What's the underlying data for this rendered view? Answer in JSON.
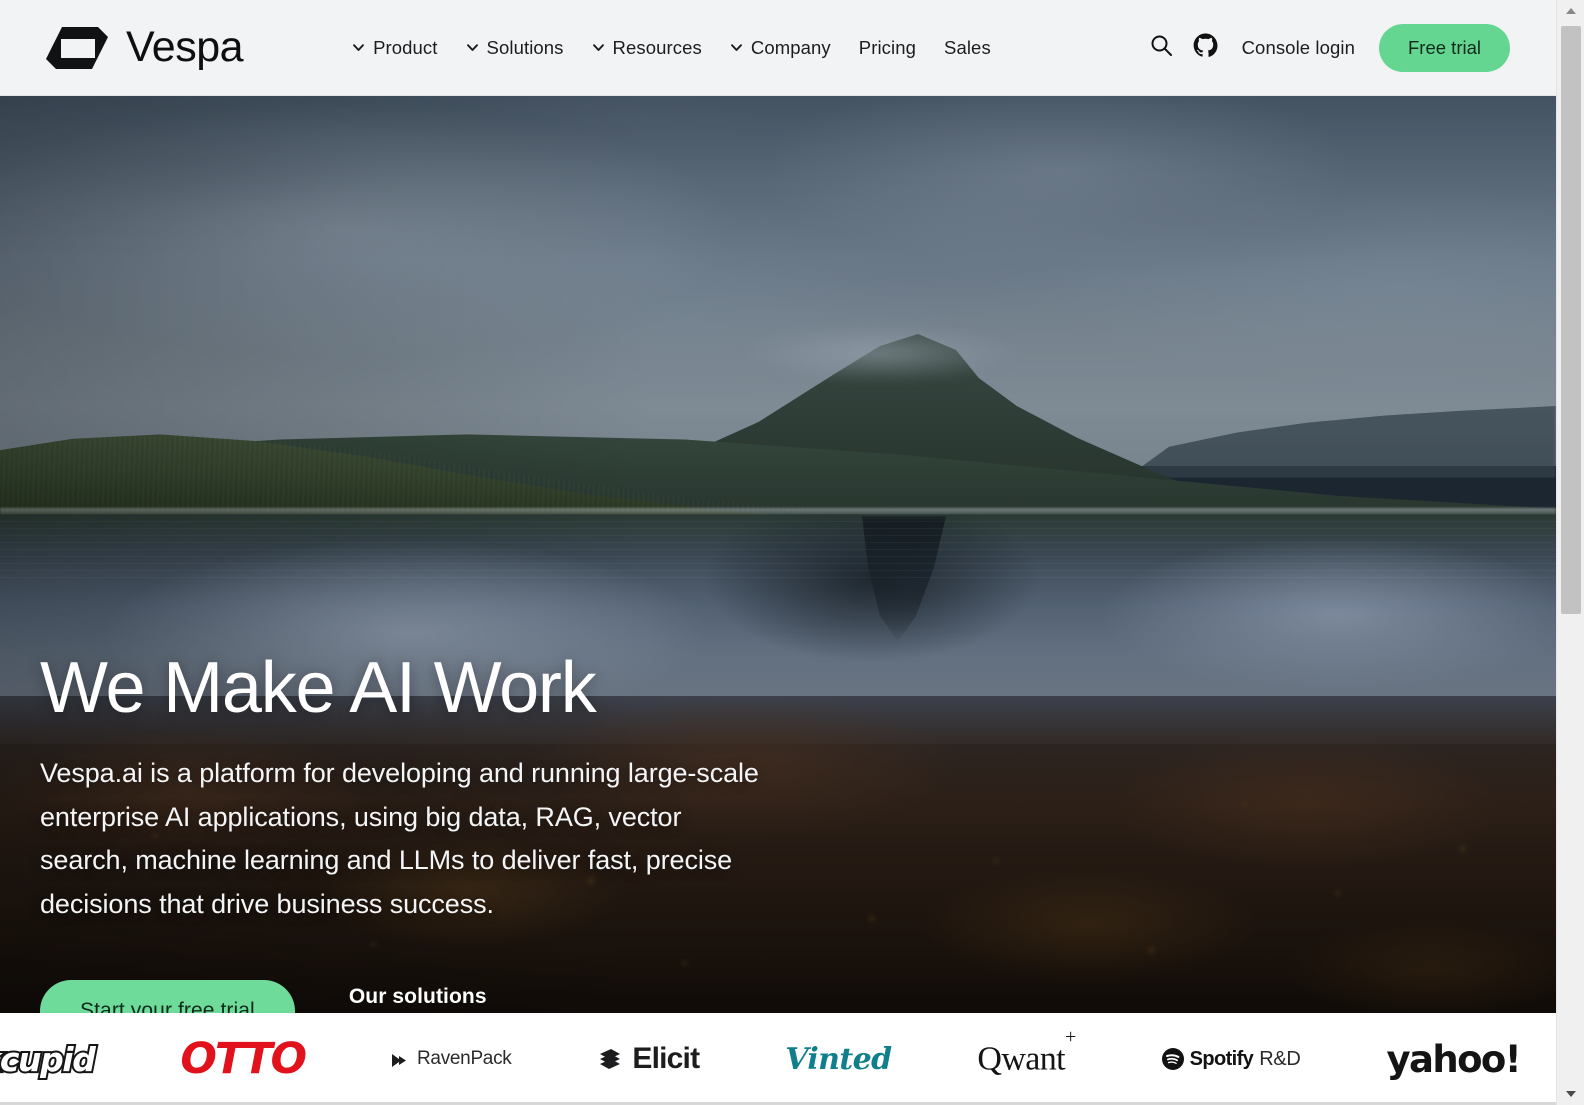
{
  "brand": {
    "name": "Vespa",
    "logo_icon": "vespa-logo-mark"
  },
  "nav": {
    "items": [
      {
        "label": "Product",
        "has_dropdown": true,
        "icon": "chevron-down-icon"
      },
      {
        "label": "Solutions",
        "has_dropdown": true,
        "icon": "chevron-down-icon"
      },
      {
        "label": "Resources",
        "has_dropdown": true,
        "icon": "chevron-down-icon"
      },
      {
        "label": "Company",
        "has_dropdown": true,
        "icon": "chevron-down-icon"
      },
      {
        "label": "Pricing",
        "has_dropdown": false,
        "icon": ""
      },
      {
        "label": "Sales",
        "has_dropdown": false,
        "icon": ""
      }
    ]
  },
  "header_actions": {
    "search_icon": "search-icon",
    "github_icon": "github-icon",
    "console_login": "Console login",
    "free_trial": "Free trial",
    "free_trial_color": "#64d692"
  },
  "hero": {
    "title": "We Make AI Work",
    "subtitle": "Vespa.ai is a platform for developing and running large-scale enterprise AI applications, using big data, RAG, vector search, machine learning and LLMs to deliver fast, precise decisions that drive business success.",
    "primary_cta": "Start your free trial",
    "secondary_cta": "Our solutions",
    "primary_cta_color": "#6fdb9a",
    "background_description": "mountain-and-lake-photograph"
  },
  "client_logos": [
    {
      "name": "okcupid",
      "text": "okcupid",
      "color": "#151515"
    },
    {
      "name": "otto",
      "text": "OTTO",
      "color": "#e1121c"
    },
    {
      "name": "ravenpack",
      "text": "RavenPack",
      "color": "#2b2b2b"
    },
    {
      "name": "elicit",
      "text": "Elicit",
      "color": "#1d1d1f"
    },
    {
      "name": "vinted",
      "text": "Vinted",
      "color": "#107f8c"
    },
    {
      "name": "qwant",
      "text": "Qwant",
      "superscript": "+",
      "color": "#141414"
    },
    {
      "name": "spotify-rd",
      "text": "Spotify",
      "suffix": "R&D",
      "color": "#121212"
    },
    {
      "name": "yahoo",
      "text": "yahoo!",
      "color": "#141414"
    }
  ],
  "scrollbar": {
    "up_arrow_icon": "scroll-up-arrow-icon",
    "down_arrow_icon": "scroll-down-arrow-icon",
    "thumb": "scrollbar-thumb"
  }
}
